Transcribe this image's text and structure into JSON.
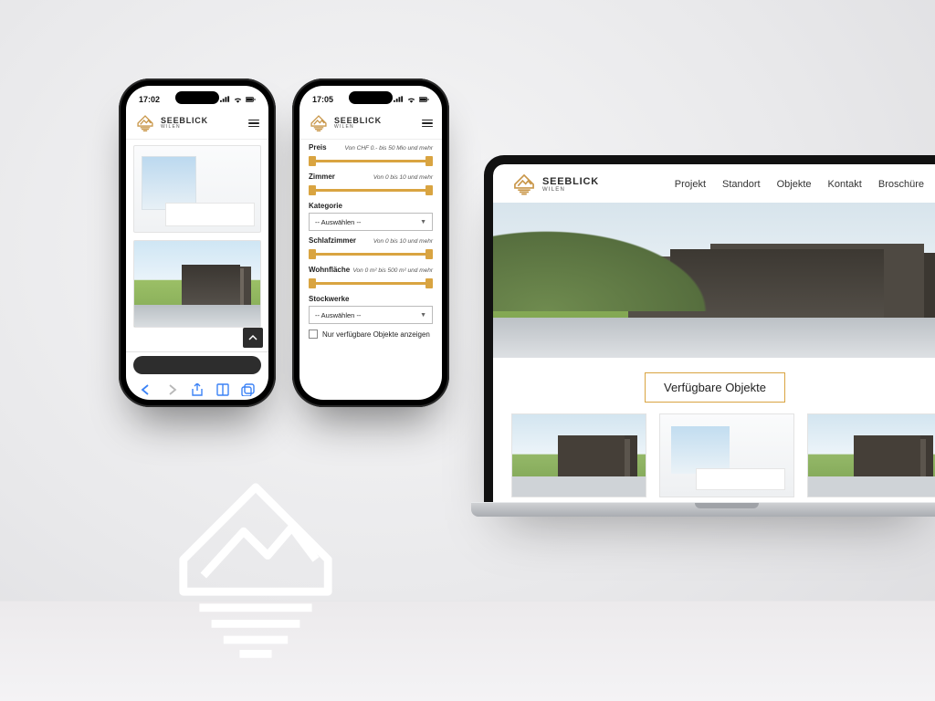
{
  "brand": {
    "name": "SEEBLICK",
    "sub": "WILEN"
  },
  "phone1": {
    "time": "17:02"
  },
  "phone2": {
    "time": "17:05",
    "filters": {
      "preis": {
        "label": "Preis",
        "range": "Von CHF 0.- bis 50 Mio und mehr"
      },
      "zimmer": {
        "label": "Zimmer",
        "range": "Von 0 bis 10 und mehr"
      },
      "kategorie": {
        "label": "Kategorie",
        "placeholder": "-- Auswählen --"
      },
      "schlafzimmer": {
        "label": "Schlafzimmer",
        "range": "Von 0 bis 10 und mehr"
      },
      "wohnflaeche": {
        "label": "Wohnfläche",
        "range": "Von 0 m² bis 500 m² und mehr"
      },
      "stockwerke": {
        "label": "Stockwerke",
        "placeholder": "-- Auswählen --"
      },
      "only_available": "Nur verfügbare Objekte anzeigen"
    }
  },
  "laptop": {
    "nav": {
      "projekt": "Projekt",
      "standort": "Standort",
      "objekte": "Objekte",
      "kontakt": "Kontakt",
      "broschuere": "Broschüre"
    },
    "cta": "Verfügbare Objekte"
  }
}
